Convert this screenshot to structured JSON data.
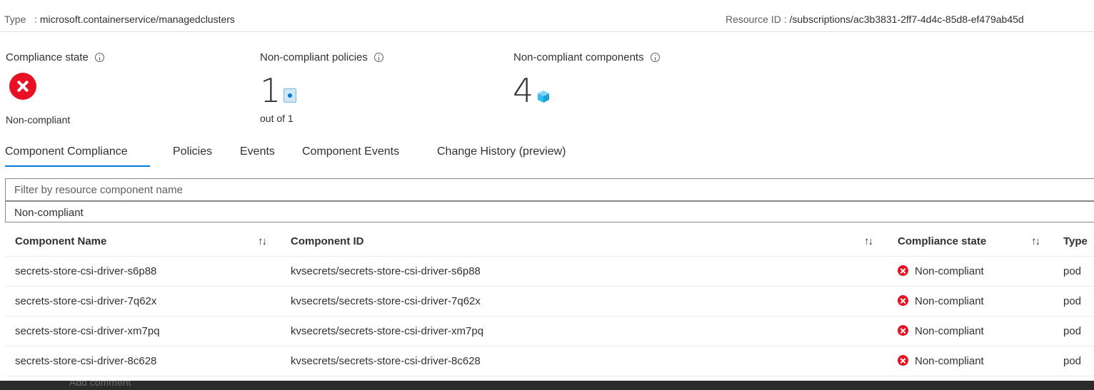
{
  "header": {
    "type_label": "Type",
    "type_sep": ":",
    "type_value": "microsoft.containerservice/managedclusters",
    "resource_id_label": "Resource ID",
    "resource_id_sep": ":",
    "resource_id_value": "/subscriptions/ac3b3831-2ff7-4d4c-85d8-ef479ab45d"
  },
  "summary": {
    "compliance_state_label": "Compliance state",
    "compliance_state_value": "Non-compliant",
    "noncompliant_policies_label": "Non-compliant policies",
    "noncompliant_policies_count": "1",
    "noncompliant_policies_outof": "out of 1",
    "noncompliant_components_label": "Non-compliant components",
    "noncompliant_components_count": "4"
  },
  "tabs": [
    {
      "label": "Component Compliance",
      "active": true
    },
    {
      "label": "Policies",
      "active": false
    },
    {
      "label": "Events",
      "active": false
    },
    {
      "label": "Component Events",
      "active": false
    },
    {
      "label": "Change History (preview)",
      "active": false
    }
  ],
  "filter": {
    "placeholder": "Filter by resource component name",
    "state_selected": "Non-compliant"
  },
  "table": {
    "columns": [
      "Component Name",
      "Component ID",
      "Compliance state",
      "Type"
    ],
    "rows": [
      {
        "name": "secrets-store-csi-driver-s6p88",
        "id": "kvsecrets/secrets-store-csi-driver-s6p88",
        "state": "Non-compliant",
        "type": "pod"
      },
      {
        "name": "secrets-store-csi-driver-7q62x",
        "id": "kvsecrets/secrets-store-csi-driver-7q62x",
        "state": "Non-compliant",
        "type": "pod"
      },
      {
        "name": "secrets-store-csi-driver-xm7pq",
        "id": "kvsecrets/secrets-store-csi-driver-xm7pq",
        "state": "Non-compliant",
        "type": "pod"
      },
      {
        "name": "secrets-store-csi-driver-8c628",
        "id": "kvsecrets/secrets-store-csi-driver-8c628",
        "state": "Non-compliant",
        "type": "pod"
      }
    ]
  },
  "footer": {
    "faded_text": "Add comment"
  },
  "icons": {
    "sort": "sort-arrows-icon",
    "status": "error-circle-icon",
    "info": "info-icon",
    "policy": "policy-document-icon",
    "component": "cube-icon"
  },
  "colors": {
    "error": "#e81123",
    "accent": "#0078d4",
    "text": "#323130",
    "muted": "#605e5c"
  }
}
